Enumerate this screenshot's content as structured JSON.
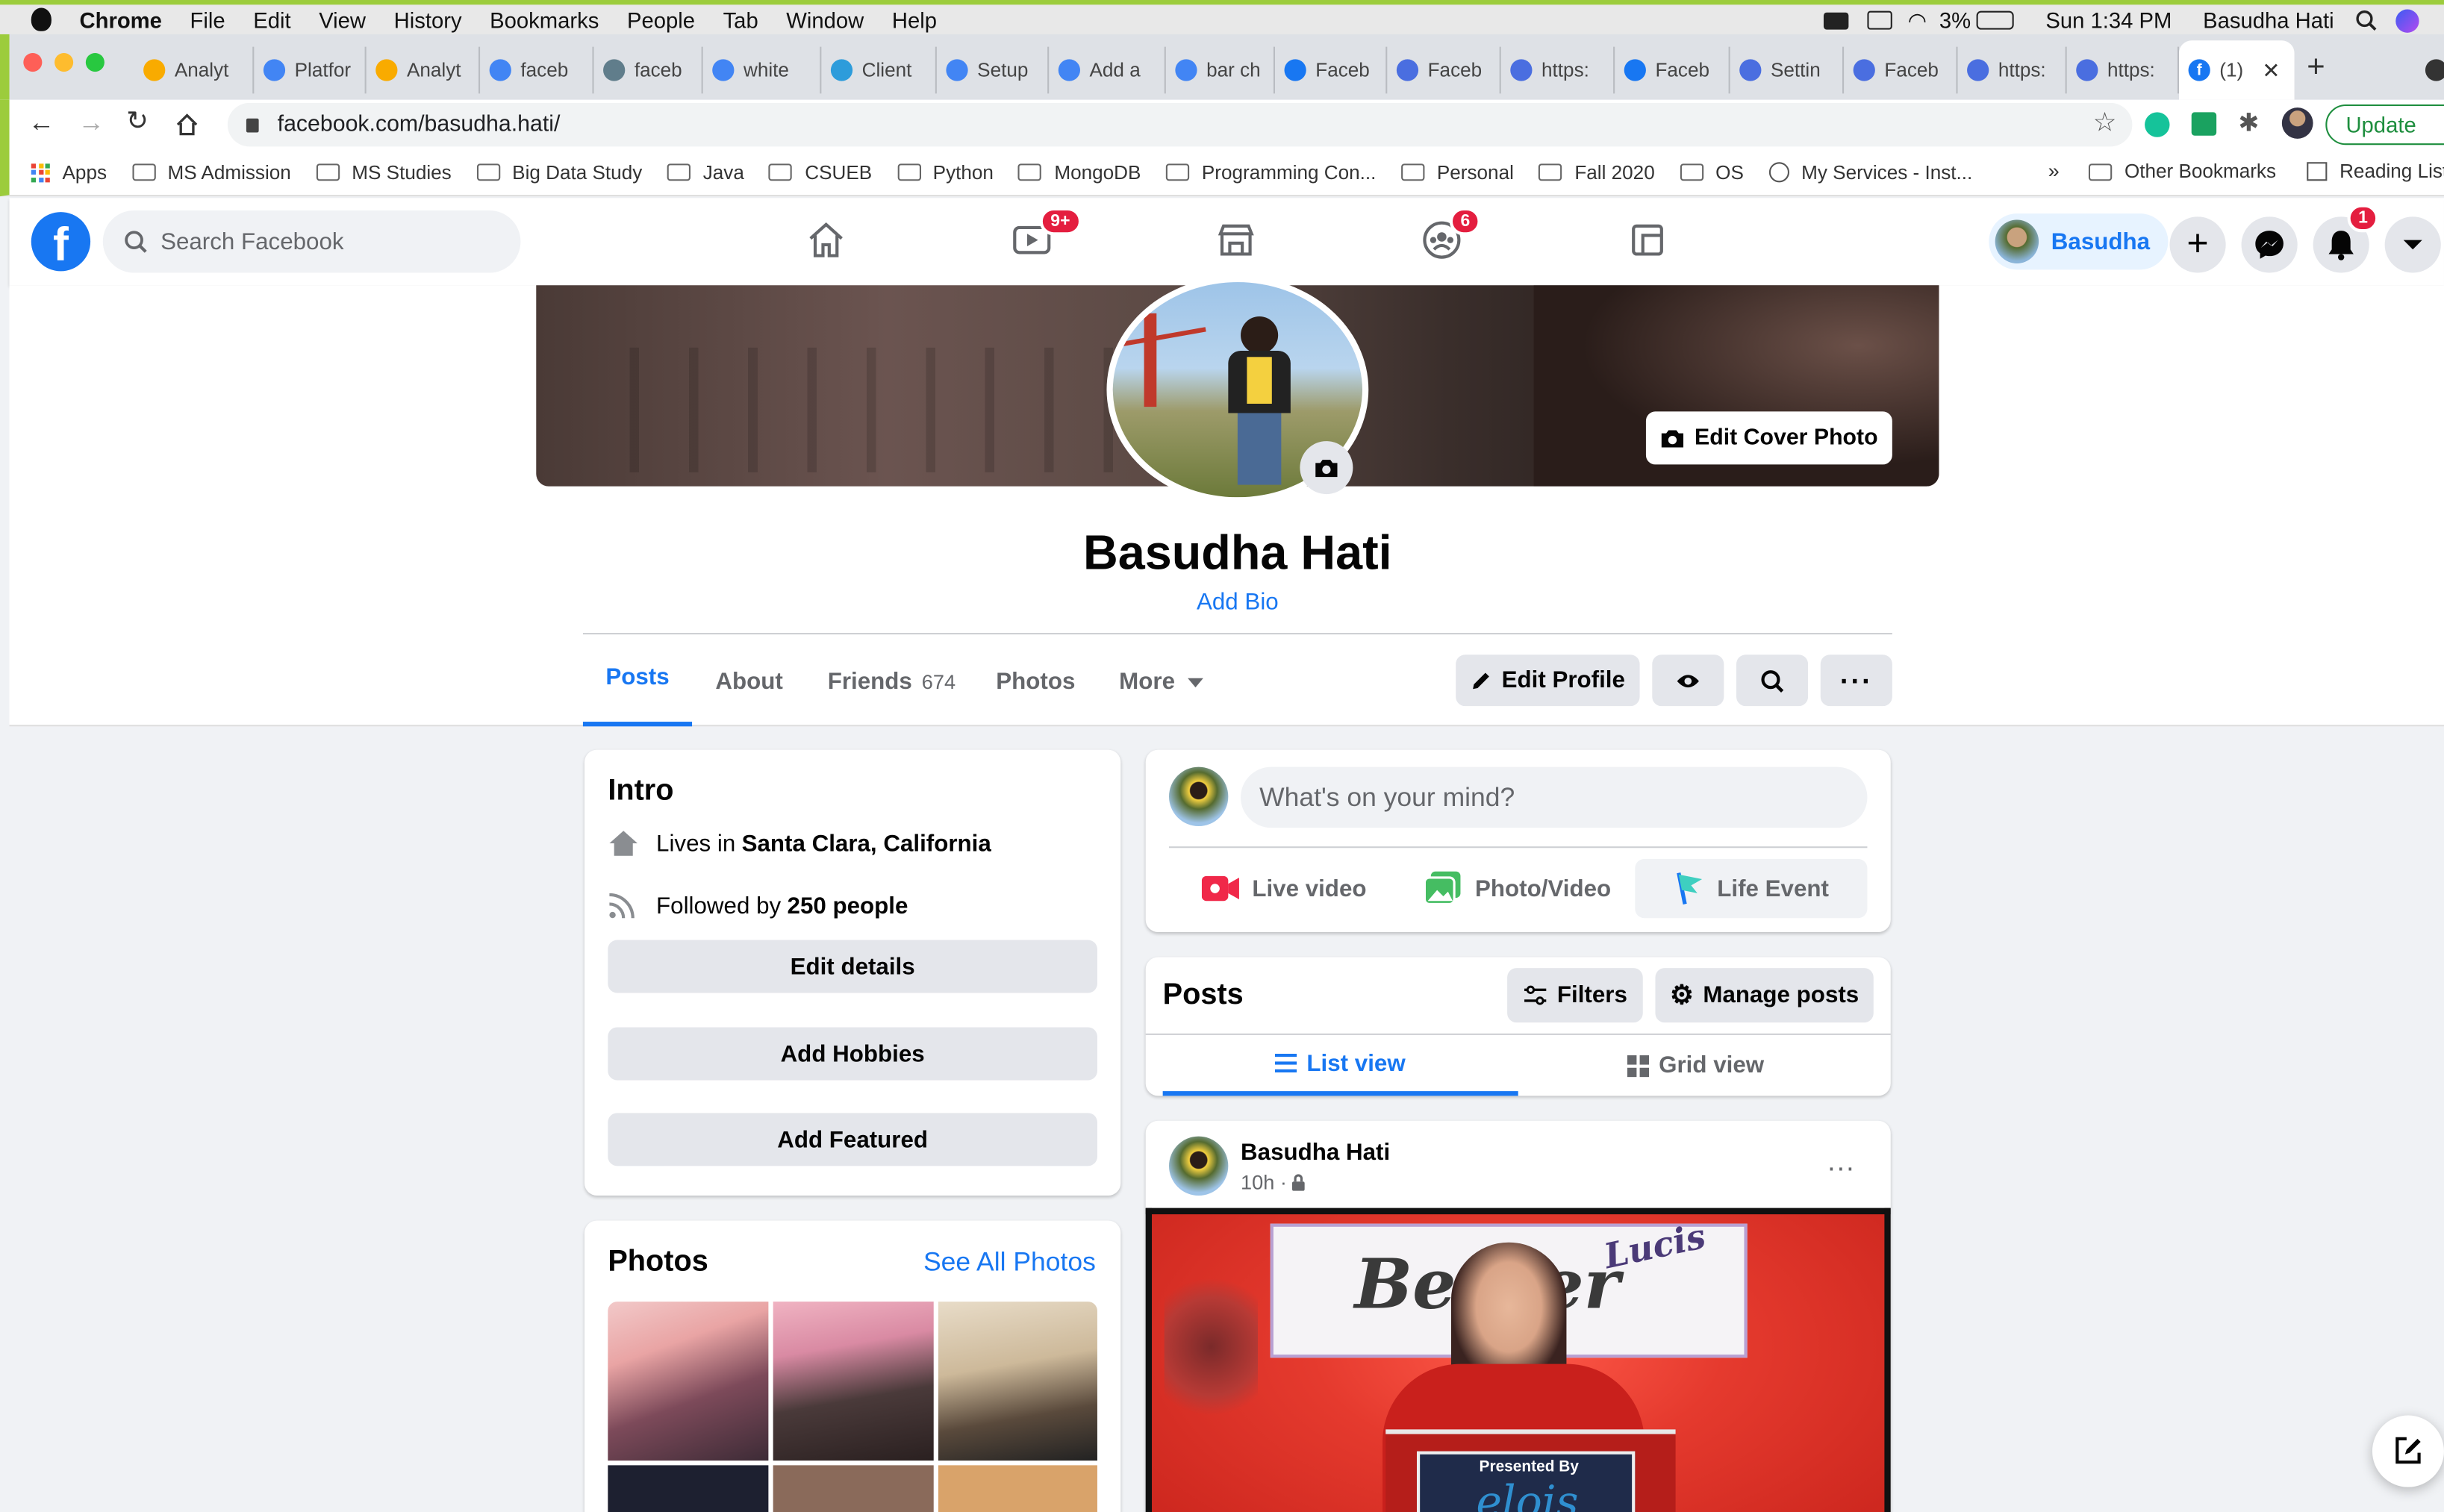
{
  "menubar": {
    "apple": "",
    "app": "Chrome",
    "items": [
      "File",
      "Edit",
      "View",
      "History",
      "Bookmarks",
      "People",
      "Tab",
      "Window",
      "Help"
    ],
    "battery": "3%",
    "clock": "Sun 1:34 PM",
    "user": "Basudha Hati"
  },
  "tabs": [
    {
      "label": "Analyt",
      "icon": "analytics-icon",
      "color": "#f9ab00"
    },
    {
      "label": "Platfor",
      "icon": "google-cloud-icon",
      "color": "#4285f4"
    },
    {
      "label": "Analyt",
      "icon": "analytics-icon",
      "color": "#f9ab00"
    },
    {
      "label": "faceb",
      "icon": "google-icon",
      "color": "#4285f4"
    },
    {
      "label": "faceb",
      "icon": "moon-icon",
      "color": "#607d8b"
    },
    {
      "label": "white",
      "icon": "google-icon",
      "color": "#4285f4"
    },
    {
      "label": "Client",
      "icon": "d-icon",
      "color": "#2d9cdb"
    },
    {
      "label": "Setup",
      "icon": "google-icon",
      "color": "#4285f4"
    },
    {
      "label": "Add a",
      "icon": "google-icon",
      "color": "#4285f4"
    },
    {
      "label": "bar ch",
      "icon": "google-icon",
      "color": "#4285f4"
    },
    {
      "label": "Faceb",
      "icon": "facebook-icon",
      "color": "#1877f2"
    },
    {
      "label": "Faceb",
      "icon": "meta-dev-icon",
      "color": "#4a6ee0"
    },
    {
      "label": "https:",
      "icon": "meta-dev-icon",
      "color": "#4a6ee0"
    },
    {
      "label": "Faceb",
      "icon": "facebook-icon",
      "color": "#1877f2"
    },
    {
      "label": "Settin",
      "icon": "gear-icon",
      "color": "#4a6ee0"
    },
    {
      "label": "Faceb",
      "icon": "meta-dev-icon",
      "color": "#4a6ee0"
    },
    {
      "label": "https:",
      "icon": "meta-dev-icon",
      "color": "#4a6ee0"
    },
    {
      "label": "https:",
      "icon": "meta-dev-icon",
      "color": "#4a6ee0"
    }
  ],
  "active_tab": {
    "label": "(1)",
    "icon": "facebook-icon"
  },
  "address": {
    "url": "facebook.com/basudha.hati/",
    "update_label": "Update"
  },
  "bookmarks": {
    "apps": "Apps",
    "items": [
      "MS Admission",
      "MS Studies",
      "Big Data Study",
      "Java",
      "CSUEB",
      "Python",
      "MongoDB",
      "Programming Con...",
      "Personal",
      "Fall 2020",
      "OS"
    ],
    "services": "My Services - Inst...",
    "more": "»",
    "other": "Other Bookmarks",
    "reading": "Reading List"
  },
  "fbnav": {
    "search_placeholder": "Search Facebook",
    "watch_badge": "9+",
    "groups_badge": "6",
    "notif_badge": "1",
    "user_short": "Basudha"
  },
  "profile": {
    "edit_cover": "Edit Cover Photo",
    "name": "Basudha Hati",
    "add_bio": "Add Bio",
    "tabs": [
      "Posts",
      "About",
      "Friends",
      "Photos",
      "More"
    ],
    "friends_count": "674",
    "edit_profile": "Edit Profile"
  },
  "intro": {
    "title": "Intro",
    "lives_prefix": "Lives in ",
    "lives_city": "Santa Clara, California",
    "followed_prefix": "Followed by ",
    "followed_count": "250 people",
    "buttons": [
      "Edit details",
      "Add Hobbies",
      "Add Featured"
    ]
  },
  "photos": {
    "title": "Photos",
    "see_all": "See All Photos"
  },
  "composer": {
    "placeholder": "What's on your mind?",
    "actions": [
      "Live video",
      "Photo/Video",
      "Life Event"
    ]
  },
  "posts_bar": {
    "title": "Posts",
    "filters": "Filters",
    "manage": "Manage posts",
    "list_view": "List view",
    "grid_view": "Grid view"
  },
  "post": {
    "author": "Basudha Hati",
    "time": "10h · ",
    "banner_brand": "Lucis",
    "banner_main": "Berger",
    "presented": "Presented By",
    "presenter_brand": "elois"
  },
  "colors": {
    "fb_blue": "#1877f2",
    "badge_red": "#e41e3f",
    "bg": "#f0f2f5"
  }
}
